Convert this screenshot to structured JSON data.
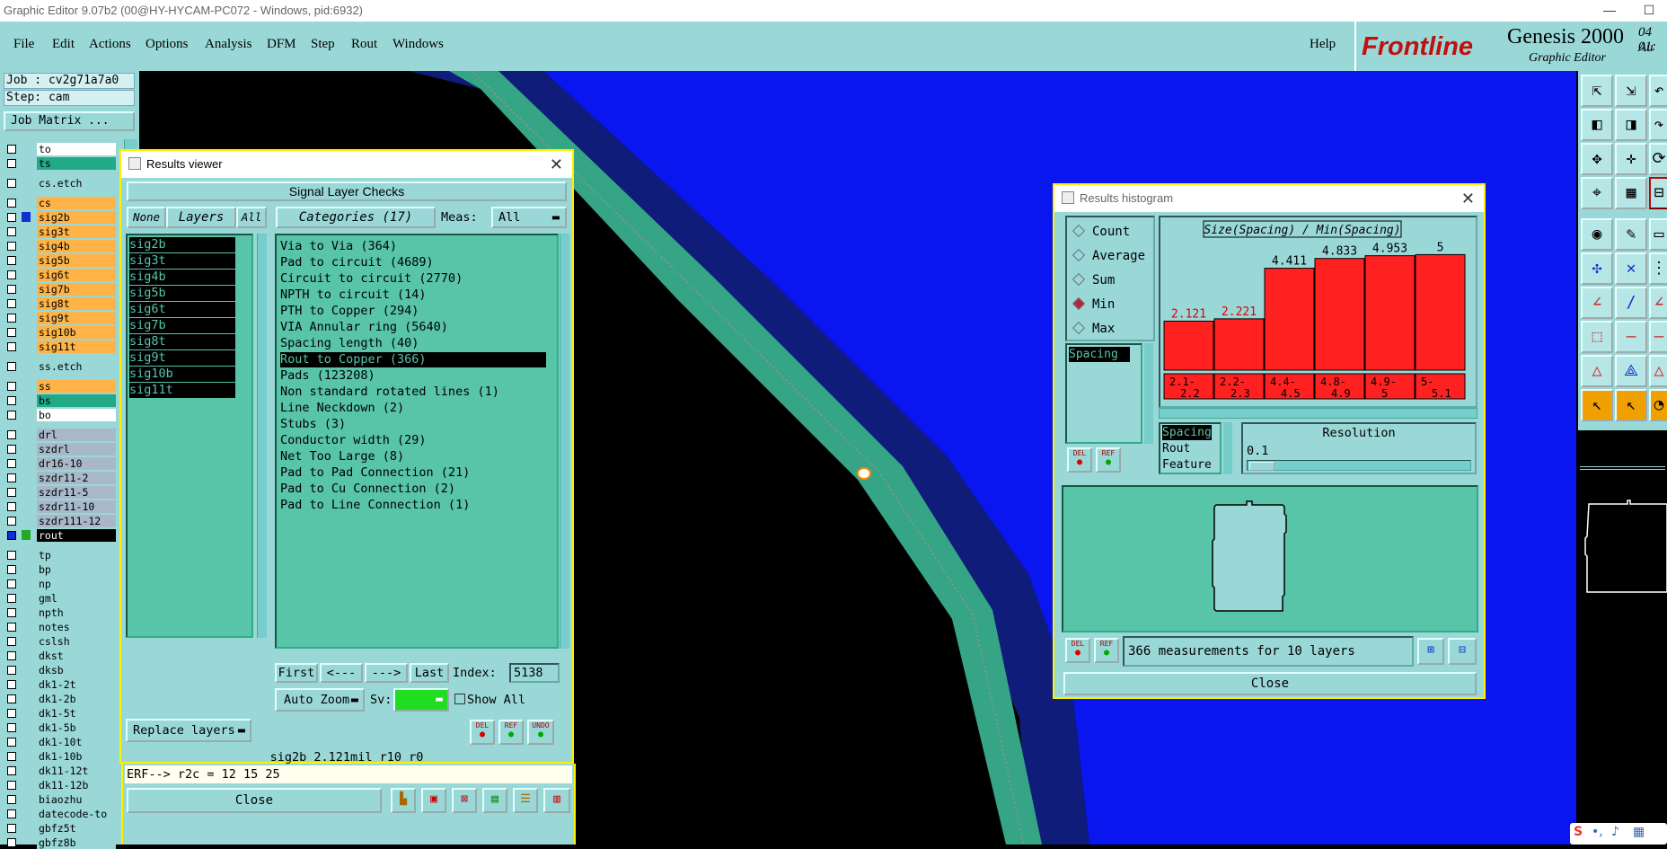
{
  "window_title": "Graphic Editor 9.07b2 (00@HY-HYCAM-PC072 - Windows, pid:6932)",
  "window_controls": {
    "minimize": "—",
    "maximize": "☐"
  },
  "menu": {
    "items": [
      "File",
      "Edit",
      "Actions",
      "Options",
      "Analysis",
      "DFM",
      "Step",
      "Rout",
      "Windows"
    ],
    "help": "Help"
  },
  "brand": {
    "logo": "Frontline",
    "product": "Genesis 2000",
    "subtitle": "Graphic Editor",
    "date_fragment": "04 Au",
    "time_fragment": "01:"
  },
  "job": {
    "job_line": "Job : cv2g71a7a0",
    "step_line": "Step: cam",
    "matrix_button": "Job Matrix ..."
  },
  "layers": [
    {
      "name": "to",
      "color": "#ffffff"
    },
    {
      "name": "ts",
      "color": "#22aa88"
    },
    {
      "name": "cs.etch",
      "color": "#9ad8d8"
    },
    {
      "name": "cs",
      "color": "#ffb347"
    },
    {
      "name": "sig2b",
      "color": "#ffb347"
    },
    {
      "name": "sig3t",
      "color": "#ffb347"
    },
    {
      "name": "sig4b",
      "color": "#ffb347"
    },
    {
      "name": "sig5b",
      "color": "#ffb347"
    },
    {
      "name": "sig6t",
      "color": "#ffb347"
    },
    {
      "name": "sig7b",
      "color": "#ffb347"
    },
    {
      "name": "sig8t",
      "color": "#ffb347"
    },
    {
      "name": "sig9t",
      "color": "#ffb347"
    },
    {
      "name": "sig10b",
      "color": "#ffb347"
    },
    {
      "name": "sig11t",
      "color": "#ffb347"
    },
    {
      "name": "ss.etch",
      "color": "#9ad8d8"
    },
    {
      "name": "ss",
      "color": "#ffb347"
    },
    {
      "name": "bs",
      "color": "#22aa88"
    },
    {
      "name": "bo",
      "color": "#ffffff"
    },
    {
      "name": "drl",
      "color": "#a8b8c8"
    },
    {
      "name": "szdrl",
      "color": "#a8b8c8"
    },
    {
      "name": "dr16-10",
      "color": "#a8b8c8"
    },
    {
      "name": "szdr11-2",
      "color": "#a8b8c8"
    },
    {
      "name": "szdr11-5",
      "color": "#a8b8c8"
    },
    {
      "name": "szdr11-10",
      "color": "#a8b8c8"
    },
    {
      "name": "szdr111-12",
      "color": "#a8b8c8"
    },
    {
      "name": "rout",
      "color": "#000000"
    },
    {
      "name": "tp",
      "color": "#9ad8d8"
    },
    {
      "name": "bp",
      "color": "#9ad8d8"
    },
    {
      "name": "np",
      "color": "#9ad8d8"
    },
    {
      "name": "gml",
      "color": "#9ad8d8"
    },
    {
      "name": "npth",
      "color": "#9ad8d8"
    },
    {
      "name": "notes",
      "color": "#9ad8d8"
    },
    {
      "name": "cslsh",
      "color": "#9ad8d8"
    },
    {
      "name": "dkst",
      "color": "#9ad8d8"
    },
    {
      "name": "dksb",
      "color": "#9ad8d8"
    },
    {
      "name": "dk1-2t",
      "color": "#9ad8d8"
    },
    {
      "name": "dk1-2b",
      "color": "#9ad8d8"
    },
    {
      "name": "dk1-5t",
      "color": "#9ad8d8"
    },
    {
      "name": "dk1-5b",
      "color": "#9ad8d8"
    },
    {
      "name": "dk1-10t",
      "color": "#9ad8d8"
    },
    {
      "name": "dk1-10b",
      "color": "#9ad8d8"
    },
    {
      "name": "dk11-12t",
      "color": "#9ad8d8"
    },
    {
      "name": "dk11-12b",
      "color": "#9ad8d8"
    },
    {
      "name": "biaozhu",
      "color": "#9ad8d8"
    },
    {
      "name": "datecode-to",
      "color": "#9ad8d8"
    },
    {
      "name": "gbfz5t",
      "color": "#9ad8d8"
    },
    {
      "name": "gbfz8b",
      "color": "#9ad8d8"
    }
  ],
  "results_viewer": {
    "title": "Results viewer",
    "header": "Signal Layer Checks",
    "none_btn": "None",
    "layers_btn": "Layers",
    "all_btn": "All",
    "categories_btn": "Categories (17)",
    "meas_label": "Meas:",
    "meas_value": "All",
    "layer_list": [
      "sig2b",
      "sig3t",
      "sig4b",
      "sig5b",
      "sig6t",
      "sig7b",
      "sig8t",
      "sig9t",
      "sig10b",
      "sig11t"
    ],
    "categories": [
      "Via to Via (364)",
      "Pad to circuit (4689)",
      "Circuit to circuit (2770)",
      "NPTH to circuit (14)",
      "PTH to Copper (294)",
      "VIA Annular ring (5640)",
      "Spacing length (40)",
      "Rout to Copper (366)",
      "Pads (123208)",
      "Non standard rotated lines (1)",
      "Line Neckdown (2)",
      "Stubs (3)",
      "Conductor width (29)",
      "Net Too Large (8)",
      "Pad to Pad Connection (21)",
      "Pad to Cu Connection (2)",
      "Pad to Line Connection (1)"
    ],
    "selected_category": "Rout to Copper (366)",
    "first_btn": "First",
    "prev_btn": "<---",
    "next_btn": "--->",
    "last_btn": "Last",
    "index_label": "Index:",
    "index_value": "5138",
    "autozoom_btn": "Auto Zoom",
    "sv_label": "Sv:",
    "show_all_label": "Show All",
    "replace_btn": "Replace layers",
    "del_btn": "DEL",
    "ref_btn": "REF",
    "undo_btn": "UNDO",
    "status_line": "sig2b 2.121mil  r10  r0",
    "erf_line": "ERF--> r2c = 12 15 25",
    "close_btn": "Close"
  },
  "results_histogram": {
    "title": "Results histogram",
    "radio_options": [
      "Count",
      "Average",
      "Sum",
      "Min",
      "Max"
    ],
    "selected_radio": "Min",
    "left_list": [
      "Spacing"
    ],
    "chart_title": "Size(Spacing) / Min(Spacing)",
    "del_btn": "DEL",
    "ref_btn": "REF",
    "attr_list": [
      "Spacing",
      "Rout",
      "Feature"
    ],
    "resolution_label": "Resolution",
    "resolution_value": "0.1",
    "status": "366 measurements for 10 layers",
    "close_btn": "Close"
  },
  "chart_data": {
    "type": "bar",
    "title": "Size(Spacing) / Min(Spacing)",
    "categories": [
      "2.1-2.2",
      "2.2-2.3",
      "4.4-4.5",
      "4.8-4.9",
      "4.9-5",
      "5-5.1"
    ],
    "values": [
      2.121,
      2.221,
      4.411,
      4.833,
      4.953,
      5
    ],
    "value_labels": [
      "2.121",
      "2.221",
      "4.411",
      "4.833",
      "4.953",
      "5"
    ],
    "label_colors": [
      "#e00000",
      "#e00000",
      "#000000",
      "#000000",
      "#000000",
      "#000000"
    ],
    "bar_color": "#ff2020",
    "ylim": [
      0,
      5.6
    ]
  }
}
